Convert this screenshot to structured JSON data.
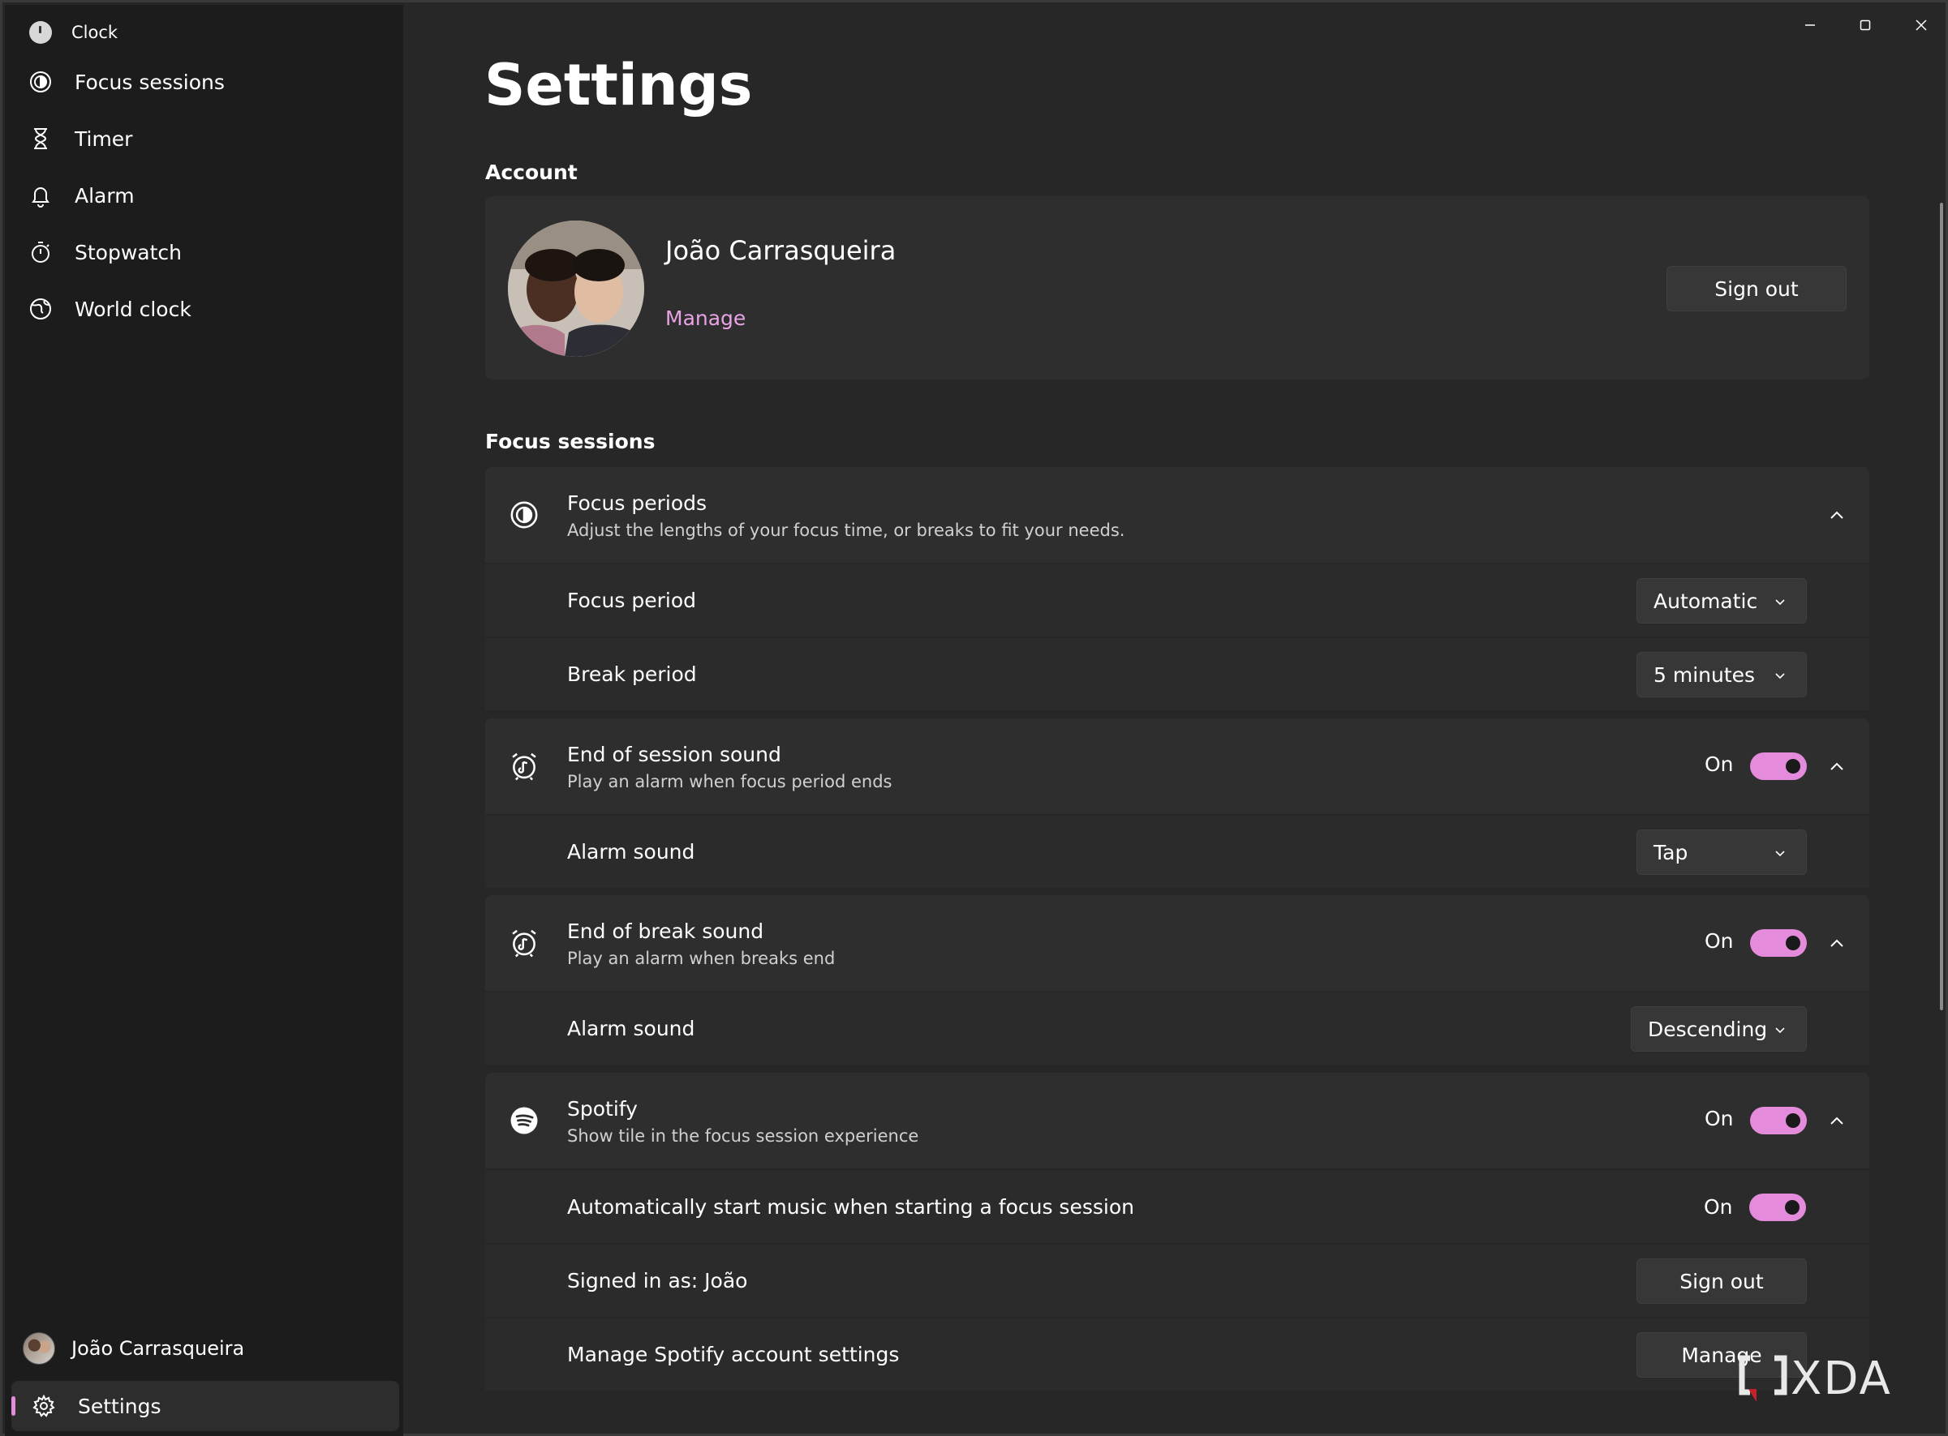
{
  "app": {
    "title": "Clock"
  },
  "sidebar": {
    "items": [
      {
        "label": "Focus sessions",
        "icon": "focus-icon"
      },
      {
        "label": "Timer",
        "icon": "hourglass-icon"
      },
      {
        "label": "Alarm",
        "icon": "bell-icon"
      },
      {
        "label": "Stopwatch",
        "icon": "stopwatch-icon"
      },
      {
        "label": "World clock",
        "icon": "globe-icon"
      }
    ],
    "user_name": "João Carrasqueira",
    "settings_label": "Settings"
  },
  "page": {
    "title": "Settings",
    "account_section": "Account",
    "focus_section": "Focus sessions"
  },
  "account": {
    "name": "João Carrasqueira",
    "manage_label": "Manage",
    "sign_out_label": "Sign out"
  },
  "focus_periods": {
    "title": "Focus periods",
    "desc": "Adjust the lengths of your focus time, or breaks to fit your needs.",
    "focus_period_label": "Focus period",
    "focus_period_value": "Automatic",
    "break_period_label": "Break period",
    "break_period_value": "5 minutes"
  },
  "end_session_sound": {
    "title": "End of session sound",
    "desc": "Play an alarm when focus period ends",
    "state": "On",
    "alarm_label": "Alarm sound",
    "alarm_value": "Tap"
  },
  "end_break_sound": {
    "title": "End of break sound",
    "desc": "Play an alarm when breaks end",
    "state": "On",
    "alarm_label": "Alarm sound",
    "alarm_value": "Descending"
  },
  "spotify": {
    "title": "Spotify",
    "desc": "Show tile in the focus session experience",
    "state": "On",
    "auto_start_label": "Automatically start music when starting a focus session",
    "auto_start_state": "On",
    "signed_in_label": "Signed in as: João",
    "sign_out_label": "Sign out",
    "manage_account_label": "Manage Spotify account settings",
    "manage_label": "Manage"
  },
  "colors": {
    "accent": "#e58bdc",
    "link": "#e9a2e3",
    "background": "#272727",
    "card": "#2e2e2e"
  },
  "watermark": {
    "text": "XDA"
  }
}
